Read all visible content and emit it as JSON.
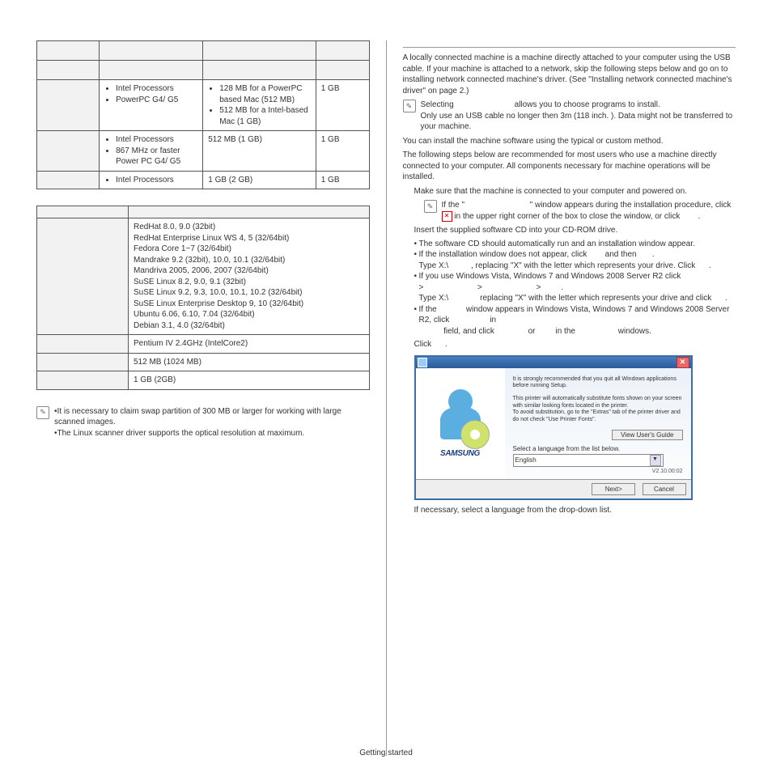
{
  "table1": {
    "rows": [
      {
        "c2": [
          "Intel Processors",
          "PowerPC G4/ G5"
        ],
        "c3": [
          "128 MB for a PowerPC based Mac (512 MB)",
          "512 MB for a Intel-based Mac (1 GB)"
        ],
        "c4": "1 GB"
      },
      {
        "c2": [
          "Intel Processors",
          "867 MHz or faster Power PC G4/ G5"
        ],
        "c3_plain": "512 MB (1 GB)",
        "c4": "1 GB"
      },
      {
        "c2": [
          "Intel Processors"
        ],
        "c3_plain": "1 GB (2 GB)",
        "c4": "1 GB"
      }
    ]
  },
  "table2": {
    "os_list": [
      "RedHat 8.0, 9.0 (32bit)",
      "RedHat Enterprise Linux WS 4, 5 (32/64bit)",
      "Fedora Core 1~7 (32/64bit)",
      "Mandrake 9.2 (32bit), 10.0, 10.1 (32/64bit)",
      "Mandriva 2005, 2006, 2007 (32/64bit)",
      "SuSE Linux 8.2, 9.0, 9.1 (32bit)",
      "SuSE Linux 9.2, 9.3, 10.0, 10.1, 10.2 (32/64bit)",
      "SuSE Linux Enterprise Desktop 9, 10 (32/64bit)",
      "Ubuntu 6.06, 6.10, 7.04 (32/64bit)",
      "Debian 3.1, 4.0 (32/64bit)"
    ],
    "cpu": "Pentium IV 2.4GHz (IntelCore2)",
    "ram": "512 MB (1024 MB)",
    "hdd": "1 GB (2GB)"
  },
  "left_notes": {
    "n1": "It is necessary to claim swap partition of 300 MB or larger for working with large scanned images.",
    "n2": "The Linux scanner driver supports the optical resolution at maximum."
  },
  "right": {
    "intro": "A locally connected machine is a machine directly attached to your computer using the USB cable. If your machine is attached to a network, skip the following steps below and go on to installing network connected machine's driver. (See \"Installing network connected machine's driver\" on page 2.)",
    "note1a": "Selecting",
    "note1b": "allows you to choose programs to install.",
    "note1c": "Only use an USB cable no longer then 3m (118 inch. ). Data might not be transferred to your machine.",
    "p2": "You can install the machine software using the typical or custom method.",
    "p3": "The following steps below are recommended for most users who use a machine directly connected to your computer. All components necessary for machine operations will be installed.",
    "s1": "Make sure that the machine is connected to your computer and powered on.",
    "s1n_a": "If the \"",
    "s1n_b": "\" window appears during the installation procedure, click ",
    "s1n_c": " in the upper right corner of the box to close the window, or click",
    "s1n_d": ".",
    "s2": "Insert the supplied software CD into your CD-ROM drive.",
    "s2a": "The software CD should automatically run and an installation window appear.",
    "s2b_1": "If the installation window does not appear, click",
    "s2b_2": "and then",
    "s2b_3": ".",
    "s2b_4": "Type X:\\",
    "s2b_5": ", replacing \"X\" with the letter which represents your drive. Click",
    "s2b_6": ".",
    "s2c_1": "If you use Windows Vista, Windows 7 and Windows 2008 Server R2 click",
    "s2c_2": ">",
    "s2c_3": ">",
    "s2c_4": ">",
    "s2c_5": ".",
    "s2c_6": "Type X:\\",
    "s2c_7": "replacing \"X\" with the letter which represents your drive and click",
    "s2c_8": ".",
    "s2d_1": "If the",
    "s2d_2": "window appears in Windows Vista, Windows 7 and Windows 2008 Server R2, click",
    "s2d_3": "in",
    "s2d_4": "field, and click",
    "s2d_5": "or",
    "s2d_6": "in the",
    "s2d_7": "windows.",
    "s3": "Click",
    "s3b": ".",
    "s4": "If necessary, select a language from the drop-down list."
  },
  "installer": {
    "rec1": "It is strongly recommended that you quit all Windows applications before running Setup.",
    "rec2": "This printer will automatically substitute fonts shown on your screen with similar looking fonts located in the printer.\nTo avoid substitution, go to the \"Extras\" tab of the printer driver and do not check \"Use Printer Fonts\".",
    "viewguide": "View User's Guide",
    "sel_label": "Select a language from the list below.",
    "lang": "English",
    "version": "V2.10.00:02",
    "next": "Next>",
    "cancel": "Cancel",
    "brand": "SAMSUNG"
  },
  "footer": "Getting started"
}
